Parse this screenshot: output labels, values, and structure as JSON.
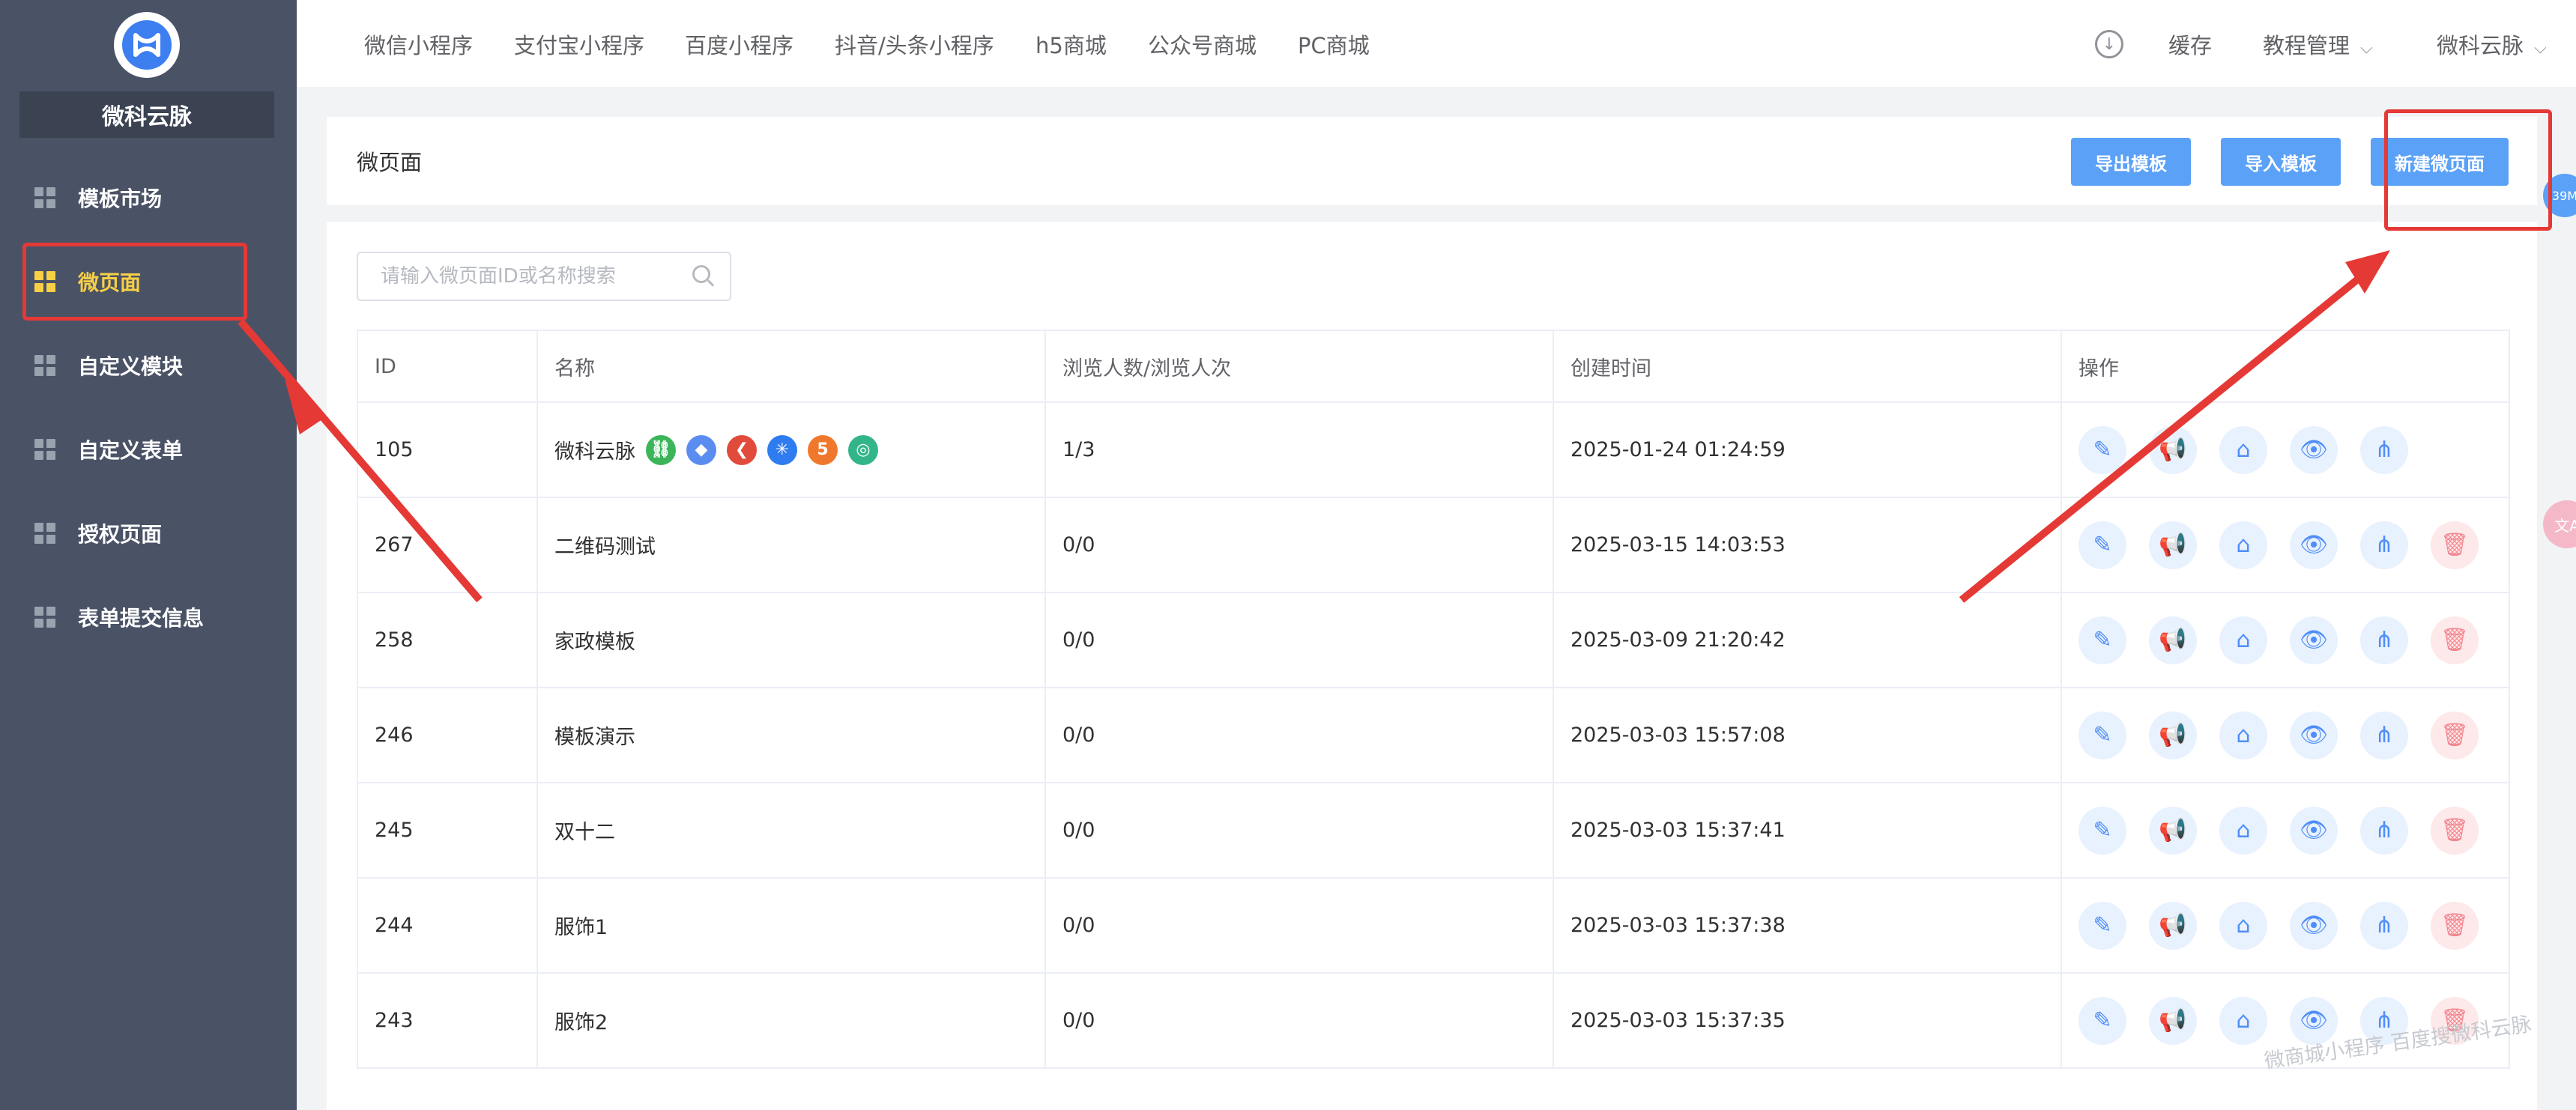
{
  "sidebar": {
    "brand": "微科云脉",
    "items": [
      {
        "label": "模板市场",
        "active": false
      },
      {
        "label": "微页面",
        "active": true
      },
      {
        "label": "自定义模块",
        "active": false
      },
      {
        "label": "自定义表单",
        "active": false
      },
      {
        "label": "授权页面",
        "active": false
      },
      {
        "label": "表单提交信息",
        "active": false
      }
    ]
  },
  "topbar": {
    "tabs": [
      "微信小程序",
      "支付宝小程序",
      "百度小程序",
      "抖音/头条小程序",
      "h5商城",
      "公众号商城",
      "PC商城"
    ],
    "cache": "缓存",
    "tutorial": "教程管理",
    "user": "微科云脉"
  },
  "header": {
    "title": "微页面",
    "export_label": "导出模板",
    "import_label": "导入模板",
    "create_label": "新建微页面"
  },
  "search": {
    "placeholder": "请输入微页面ID或名称搜索"
  },
  "table": {
    "columns": [
      "ID",
      "名称",
      "浏览人数/浏览人次",
      "创建时间",
      "操作"
    ],
    "rows": [
      {
        "id": "105",
        "name": "微科云脉",
        "views": "1/3",
        "created": "2025-01-24 01:24:59"
      },
      {
        "id": "267",
        "name": "二维码测试",
        "views": "0/0",
        "created": "2025-03-15 14:03:53"
      },
      {
        "id": "258",
        "name": "家政模板",
        "views": "0/0",
        "created": "2025-03-09 21:20:42"
      },
      {
        "id": "246",
        "name": "模板演示",
        "views": "0/0",
        "created": "2025-03-03 15:57:08"
      },
      {
        "id": "245",
        "name": "双十二",
        "views": "0/0",
        "created": "2025-03-03 15:37:41"
      },
      {
        "id": "244",
        "name": "服饰1",
        "views": "0/0",
        "created": "2025-03-03 15:37:38"
      },
      {
        "id": "243",
        "name": "服饰2",
        "views": "0/0",
        "created": "2025-03-03 15:37:35"
      }
    ]
  },
  "watermark": "微商城小程序 百度搜微科云脉",
  "badge": "39M",
  "colors": {
    "sidebar": "#4a5266",
    "active": "#f7d046",
    "primary": "#5aa1f7",
    "annotation": "#e53935"
  }
}
